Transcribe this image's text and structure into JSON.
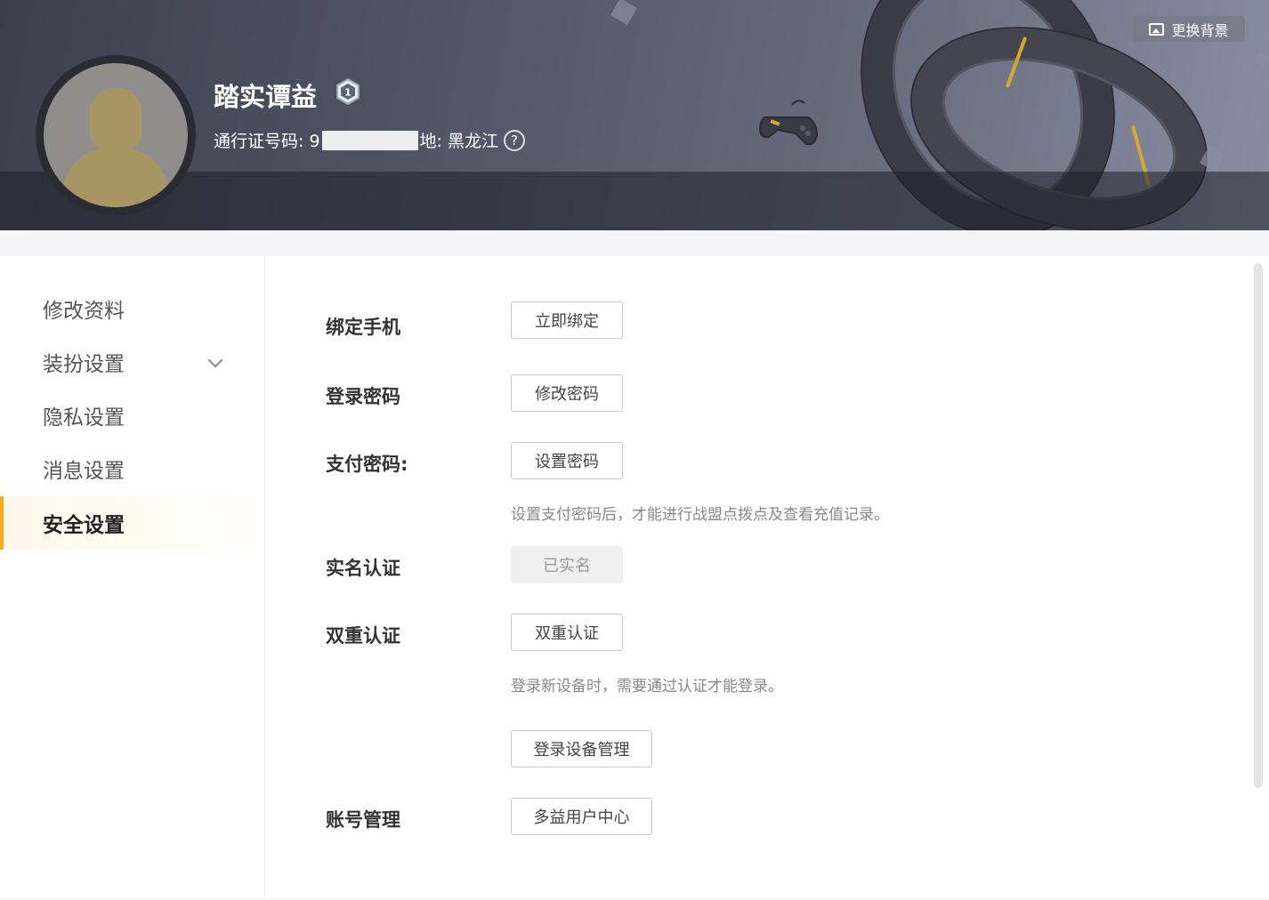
{
  "header": {
    "username": "踏实谭益",
    "level": "1",
    "passport_label": "通行证号码: 9",
    "location_label": "地: 黑龙江",
    "help_glyph": "?",
    "change_background": "更换背景"
  },
  "sidebar": {
    "items": [
      {
        "label": "修改资料"
      },
      {
        "label": "装扮设置"
      },
      {
        "label": "隐私设置"
      },
      {
        "label": "消息设置"
      },
      {
        "label": "安全设置"
      }
    ]
  },
  "security": {
    "phone": {
      "label": "绑定手机",
      "button": "立即绑定"
    },
    "login_password": {
      "label": "登录密码",
      "button": "修改密码"
    },
    "pay_password": {
      "label": "支付密码:",
      "button": "设置密码",
      "hint": "设置支付密码后，才能进行战盟点拨点及查看充值记录。"
    },
    "realname": {
      "label": "实名认证",
      "button": "已实名"
    },
    "two_factor": {
      "label": "双重认证",
      "button": "双重认证",
      "hint": "登录新设备时，需要通过认证才能登录。"
    },
    "device_manage": {
      "button": "登录设备管理"
    },
    "account": {
      "label": "账号管理",
      "button": "多益用户中心"
    }
  },
  "colors": {
    "accent": "#f4ae1c",
    "active_bg": "#fff8ea"
  }
}
